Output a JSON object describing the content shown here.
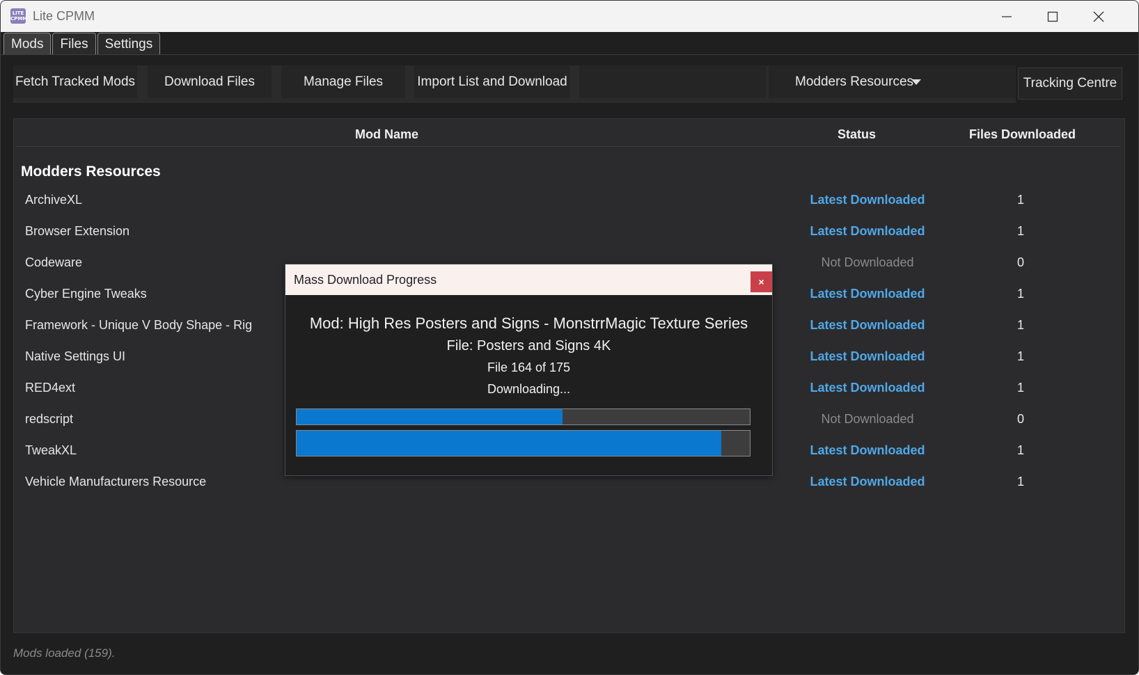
{
  "window": {
    "title": "Lite CPMM",
    "icon_text": "LITE CPMM"
  },
  "tabs": [
    {
      "label": "Mods"
    },
    {
      "label": "Files"
    },
    {
      "label": "Settings"
    }
  ],
  "toolbar": {
    "fetch": "Fetch Tracked Mods",
    "download": "Download Files",
    "manage": "Manage Files",
    "import": "Import List and Download",
    "category_value": "Modders Resources",
    "tracking": "Tracking Centre"
  },
  "table": {
    "headers": {
      "name": "Mod Name",
      "status": "Status",
      "files": "Files Downloaded"
    },
    "group": "Modders Resources",
    "rows": [
      {
        "name": "ArchiveXL",
        "status": "Latest Downloaded",
        "files": "1"
      },
      {
        "name": "Browser Extension",
        "status": "Latest Downloaded",
        "files": "1"
      },
      {
        "name": "Codeware",
        "status": "Not Downloaded",
        "files": "0"
      },
      {
        "name": "Cyber Engine Tweaks",
        "status": "Latest Downloaded",
        "files": "1"
      },
      {
        "name": "Framework - Unique V Body Shape - Rig",
        "status": "Latest Downloaded",
        "files": "1"
      },
      {
        "name": "Native Settings UI",
        "status": "Latest Downloaded",
        "files": "1"
      },
      {
        "name": "RED4ext",
        "status": "Latest Downloaded",
        "files": "1"
      },
      {
        "name": "redscript",
        "status": "Not Downloaded",
        "files": "0"
      },
      {
        "name": "TweakXL",
        "status": "Latest Downloaded",
        "files": "1"
      },
      {
        "name": "Vehicle Manufacturers Resource",
        "status": "Latest Downloaded",
        "files": "1"
      }
    ]
  },
  "status_bar": "Mods loaded (159).",
  "dialog": {
    "title": "Mass Download Progress",
    "close_glyph": "×",
    "mod_line": "Mod: High Res Posters and Signs - MonstrrMagic Texture Series",
    "file_line": "File: Posters and Signs 4K",
    "count_line": "File 164 of 175",
    "state_line": "Downloading...",
    "file_progress_fraction": 0.587,
    "overall_progress_fraction": 0.937
  },
  "colors": {
    "accent_status": "#4fa8e8",
    "progress_fill": "#0a78cf",
    "close_button": "#c9404a"
  }
}
